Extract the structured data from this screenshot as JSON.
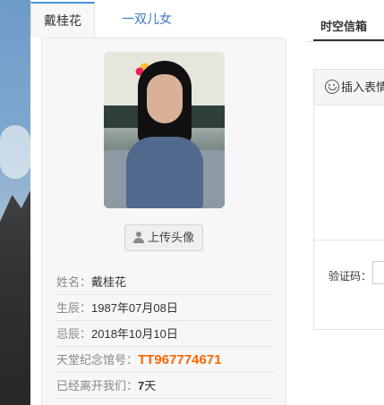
{
  "tabs": [
    {
      "label": "戴桂花",
      "active": true
    },
    {
      "label": "一双儿女",
      "active": false
    }
  ],
  "profile": {
    "upload_label": "上传头像",
    "fields": [
      {
        "key": "姓名：",
        "value": "戴桂花"
      },
      {
        "key": "生辰：",
        "value": "1987年07月08日"
      },
      {
        "key": "忌辰：",
        "value": "2018年10月10日"
      },
      {
        "key": "天堂纪念馆号：",
        "value": "TT967774671"
      },
      {
        "key": "已经离开我们：",
        "value": "7",
        "unit": "天"
      }
    ]
  },
  "right": {
    "tab_label": "时空信箱",
    "insert_emoji_label": "插入表情",
    "captcha_label": "验证码："
  },
  "colors": {
    "accent_blue": "#4a90d9",
    "hall_number_orange": "#ff6600"
  },
  "icons": {
    "upload": "user-icon",
    "emoji": "smile-icon"
  }
}
